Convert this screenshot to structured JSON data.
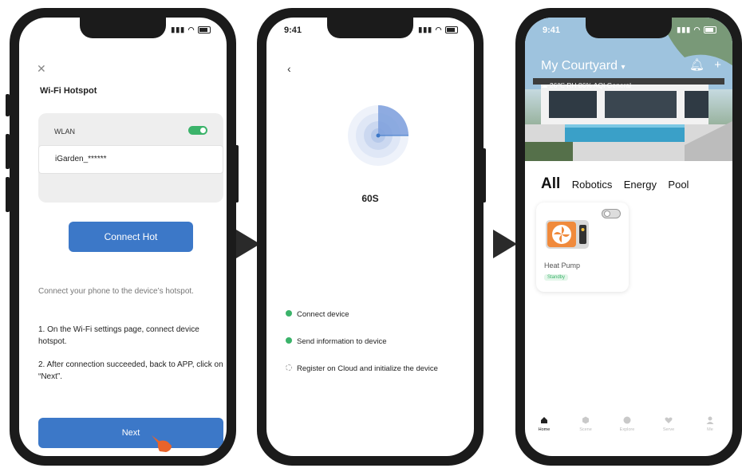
{
  "phone1": {
    "close_icon": "close-icon",
    "title": "Wi-Fi Hotspot",
    "wlan_label": "WLAN",
    "wlan_enabled": true,
    "ssid": "iGarden_******",
    "connect_button": "Connect Hot",
    "intro": "Connect your phone to the device’s hotspot.",
    "step1": "1. On the Wi-Fi settings page, connect device hotspot.",
    "step2": "2. After connection succeeded, back to APP, click on “Next”.",
    "next_button": "Next"
  },
  "phone2": {
    "time": "9:41",
    "countdown": "60S",
    "steps": [
      {
        "label": "Connect device",
        "status": "done"
      },
      {
        "label": "Send information to device",
        "status": "done"
      },
      {
        "label": "Register on Cloud and initialize the device",
        "status": "pending"
      }
    ]
  },
  "phone3": {
    "time": "9:41",
    "home_name": "My Courtyard",
    "weather": "26℃  RH 86%  AQI General",
    "tabs": [
      "All",
      "Robotics",
      "Energy",
      "Pool"
    ],
    "device": {
      "name": "Heat Pump",
      "status": "Standby",
      "on": false
    },
    "nav": [
      "Home",
      "Scene",
      "Explore",
      "Serve",
      "Me"
    ]
  },
  "colors": {
    "primary": "#3c78c8",
    "success": "#3bb36a",
    "phone_frame": "#1b1b1b",
    "arrow": "#2a2a2a"
  }
}
